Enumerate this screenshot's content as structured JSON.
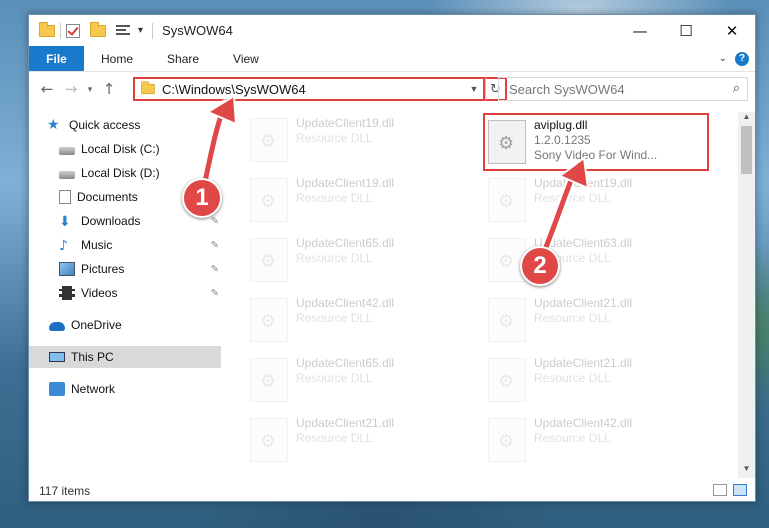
{
  "window": {
    "title": "SysWOW64",
    "minimize": "—",
    "maximize": "☐",
    "close": "✕"
  },
  "ribbon": {
    "tabs": [
      "File",
      "Home",
      "Share",
      "View"
    ],
    "help": "?",
    "expand": "⌄"
  },
  "address": {
    "path": "C:\\Windows\\SysWOW64",
    "search_placeholder": "Search SysWOW64"
  },
  "nav": {
    "items": [
      {
        "label": "Quick access",
        "icon": "star-icon",
        "pinned": false
      },
      {
        "label": "Local Disk (C:)",
        "icon": "disk-icon",
        "pinned": false
      },
      {
        "label": "Local Disk (D:)",
        "icon": "disk-icon",
        "pinned": false
      },
      {
        "label": "Documents",
        "icon": "documents-icon",
        "pinned": true
      },
      {
        "label": "Downloads",
        "icon": "downloads-icon",
        "pinned": true
      },
      {
        "label": "Music",
        "icon": "music-icon",
        "pinned": true
      },
      {
        "label": "Pictures",
        "icon": "pictures-icon",
        "pinned": true
      },
      {
        "label": "Videos",
        "icon": "videos-icon",
        "pinned": true
      },
      {
        "label": "OneDrive",
        "icon": "onedrive-icon",
        "pinned": false
      },
      {
        "label": "This PC",
        "icon": "this-pc-icon",
        "pinned": false
      },
      {
        "label": "Network",
        "icon": "network-icon",
        "pinned": false
      }
    ]
  },
  "files": {
    "highlighted": {
      "name": "aviplug.dll",
      "version": "1.2.0.1235",
      "description": "Sony Video For Wind..."
    },
    "left_column": [
      {
        "name": "UpdateClient19.dll",
        "type": "Resource DLL"
      },
      {
        "name": "UpdateClient19.dll",
        "type": "Resource DLL"
      },
      {
        "name": "UpdateClient65.dll",
        "type": "Resource DLL"
      },
      {
        "name": "UpdateClient42.dll",
        "type": "Resource DLL"
      },
      {
        "name": "UpdateClient65.dll",
        "type": "Resource DLL"
      },
      {
        "name": "UpdateClient21.dll",
        "type": "Resource DLL"
      }
    ],
    "right_column": [
      {
        "name": "UpdateClient19.dll",
        "type": "Resource DLL"
      },
      {
        "name": "UpdateClient63.dll",
        "type": "Resource DLL"
      },
      {
        "name": "UpdateClient21.dll",
        "type": "Resource DLL"
      },
      {
        "name": "UpdateClient21.dll",
        "type": "Resource DLL"
      },
      {
        "name": "UpdateClient42.dll",
        "type": "Resource DLL"
      }
    ]
  },
  "status": {
    "item_count": "117 items"
  },
  "markers": {
    "step1": "1",
    "step2": "2"
  },
  "colors": {
    "accent": "#1979ca",
    "highlight_red": "#e0413f",
    "marker_red": "#e04848"
  }
}
